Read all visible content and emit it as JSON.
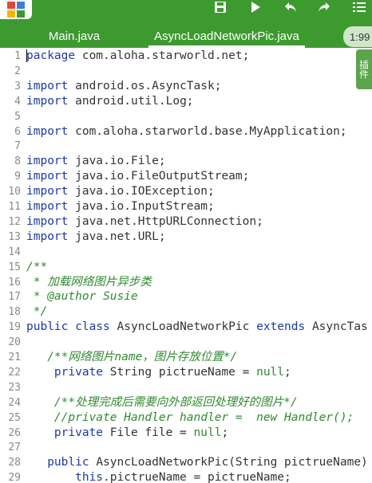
{
  "toolbar": {
    "app_icon": "android-studio-style grid icon",
    "buttons": [
      {
        "name": "save-icon"
      },
      {
        "name": "run-icon"
      },
      {
        "name": "undo-icon"
      },
      {
        "name": "redo-icon"
      },
      {
        "name": "menu-list-icon"
      }
    ]
  },
  "tabs": [
    {
      "label": "Main.java",
      "active": false
    },
    {
      "label": "AsyncLoadNetworkPic.java",
      "active": true
    }
  ],
  "clock": "1:99",
  "plugin_tab": "插件",
  "colors": {
    "toolbar_bg": "#3d9a2f",
    "keyword": "#1a3aa3",
    "comment": "#2f8a2f",
    "line_number": "#8a8a8a"
  },
  "lines": [
    {
      "n": "1",
      "parts": [
        [
          "kw",
          "package"
        ],
        [
          "t",
          " com.aloha.starworld.net;"
        ]
      ]
    },
    {
      "n": "2",
      "parts": []
    },
    {
      "n": "3",
      "parts": [
        [
          "kw",
          "import"
        ],
        [
          "t",
          " android.os.AsyncTask;"
        ]
      ]
    },
    {
      "n": "4",
      "parts": [
        [
          "kw",
          "import"
        ],
        [
          "t",
          " android.util.Log;"
        ]
      ]
    },
    {
      "n": "5",
      "parts": []
    },
    {
      "n": "6",
      "parts": [
        [
          "kw",
          "import"
        ],
        [
          "t",
          " com.aloha.starworld.base.MyApplication;"
        ]
      ]
    },
    {
      "n": "7",
      "parts": []
    },
    {
      "n": "8",
      "parts": [
        [
          "kw",
          "import"
        ],
        [
          "t",
          " java.io.File;"
        ]
      ]
    },
    {
      "n": "9",
      "parts": [
        [
          "kw",
          "import"
        ],
        [
          "t",
          " java.io.FileOutputStream;"
        ]
      ]
    },
    {
      "n": "10",
      "parts": [
        [
          "kw",
          "import"
        ],
        [
          "t",
          " java.io.IOException;"
        ]
      ]
    },
    {
      "n": "11",
      "parts": [
        [
          "kw",
          "import"
        ],
        [
          "t",
          " java.io.InputStream;"
        ]
      ]
    },
    {
      "n": "12",
      "parts": [
        [
          "kw",
          "import"
        ],
        [
          "t",
          " java.net.HttpURLConnection;"
        ]
      ]
    },
    {
      "n": "13",
      "parts": [
        [
          "kw",
          "import"
        ],
        [
          "t",
          " java.net.URL;"
        ]
      ]
    },
    {
      "n": "14",
      "parts": []
    },
    {
      "n": "15",
      "parts": [
        [
          "cm",
          "/**"
        ]
      ]
    },
    {
      "n": "16",
      "parts": [
        [
          "cm",
          " * 加载网络图片异步类"
        ]
      ]
    },
    {
      "n": "17",
      "parts": [
        [
          "cm",
          " * @author Susie"
        ]
      ]
    },
    {
      "n": "18",
      "parts": [
        [
          "cm",
          " */"
        ]
      ]
    },
    {
      "n": "19",
      "parts": [
        [
          "kw",
          "public"
        ],
        [
          "t",
          " "
        ],
        [
          "kw",
          "class"
        ],
        [
          "t",
          " AsyncLoadNetworkPic "
        ],
        [
          "kw",
          "extends"
        ],
        [
          "t",
          " AsyncTas"
        ]
      ]
    },
    {
      "n": "20",
      "parts": []
    },
    {
      "n": "21",
      "parts": [
        [
          "t",
          "   "
        ],
        [
          "cm",
          "/**网络图片name，图片存放位置*/"
        ]
      ]
    },
    {
      "n": "22",
      "parts": [
        [
          "t",
          "    "
        ],
        [
          "kw",
          "private"
        ],
        [
          "t",
          " String pictrueName = "
        ],
        [
          "lit",
          "null"
        ],
        [
          "t",
          ";"
        ]
      ]
    },
    {
      "n": "23",
      "parts": []
    },
    {
      "n": "24",
      "parts": [
        [
          "t",
          "    "
        ],
        [
          "cm",
          "/**处理完成后需要向外部返回处理好的图片*/"
        ]
      ]
    },
    {
      "n": "25",
      "parts": [
        [
          "t",
          "    "
        ],
        [
          "cm",
          "//private Handler handler =  new Handler();"
        ]
      ]
    },
    {
      "n": "26",
      "parts": [
        [
          "t",
          "    "
        ],
        [
          "kw",
          "private"
        ],
        [
          "t",
          " File file = "
        ],
        [
          "lit",
          "null"
        ],
        [
          "t",
          ";"
        ]
      ]
    },
    {
      "n": "27",
      "parts": []
    },
    {
      "n": "28",
      "parts": [
        [
          "t",
          "   "
        ],
        [
          "kw",
          "public"
        ],
        [
          "t",
          " AsyncLoadNetworkPic(String pictrueName)"
        ]
      ]
    },
    {
      "n": "29",
      "parts": [
        [
          "t",
          "       "
        ],
        [
          "kw",
          "this"
        ],
        [
          "t",
          ".pictrueName = pictrueName;"
        ]
      ]
    }
  ]
}
